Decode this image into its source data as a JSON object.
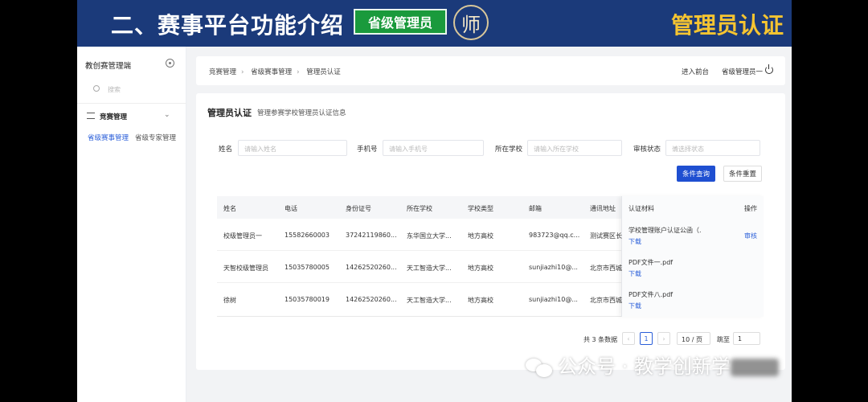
{
  "banner": {
    "title": "二、赛事平台功能介绍",
    "badge": "省级管理员",
    "logo_char": "师",
    "right": "管理员认证"
  },
  "sidebar": {
    "title": "教创赛管理端",
    "search_placeholder": "搜索",
    "menu": "竞赛管理",
    "sub_active": "省级赛事管理",
    "sub_other": "省级专家管理"
  },
  "topbar": {
    "crumbs": [
      "竞赛管理",
      "省级赛事管理",
      "管理员认证"
    ],
    "front": "进入前台",
    "user": "省级管理员一"
  },
  "panel": {
    "title": "管理员认证",
    "subtitle": "管理参赛学校管理员认证信息"
  },
  "filters": {
    "name_label": "姓名",
    "name_ph": "请输入姓名",
    "phone_label": "手机号",
    "phone_ph": "请输入手机号",
    "school_label": "所在学校",
    "school_ph": "请输入所在学校",
    "status_label": "审核状态",
    "status_ph": "请选择状态",
    "search_btn": "条件查询",
    "reset_btn": "条件重置"
  },
  "table": {
    "headers": [
      "姓名",
      "电话",
      "身份证号",
      "所在学校",
      "学校类型",
      "邮箱",
      "通讯地址",
      "认证材料",
      "操作"
    ],
    "rows": [
      {
        "name": "校级管理员一",
        "phone": "15582660003",
        "id": "37242119860...",
        "school": "东华国立大学...",
        "type": "地方高校",
        "email": "983723@qq.c...",
        "addr": "测试赛区长",
        "material": "学校管理账户认证公函（.",
        "download": "下载",
        "op": "审核"
      },
      {
        "name": "天智校级管理员",
        "phone": "15035780005",
        "id": "14262520260...",
        "school": "天工智造大学...",
        "type": "地方高校",
        "email": "sunjiazhi10@...",
        "addr": "北京市西城",
        "material": "PDF文件一.pdf",
        "download": "下载",
        "op": ""
      },
      {
        "name": "徐树",
        "phone": "15035780019",
        "id": "14262520260...",
        "school": "天工智造大学...",
        "type": "地方高校",
        "email": "sunjiazhi10@...",
        "addr": "北京市西城",
        "material": "PDF文件八.pdf",
        "download": "下载",
        "op": ""
      }
    ]
  },
  "pager": {
    "total": "共 3 条数据",
    "prev": "‹",
    "page": "1",
    "next": "›",
    "size": "10 / 页",
    "jump": "跳至",
    "jump_val": "1"
  },
  "watermark": {
    "text": "公众号 · 教学创新学"
  }
}
